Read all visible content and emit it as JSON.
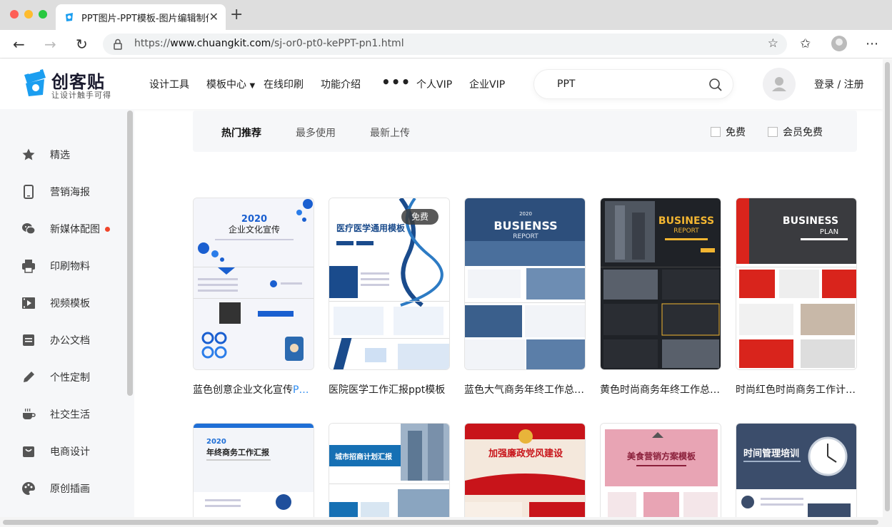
{
  "browser": {
    "tab_title": "PPT图片-PPT模板-图片编辑制作",
    "url_prefix": "https://",
    "url_domain": "www.chuangkit.com",
    "url_path": "/sj-or0-pt0-kePPT-pn1.html"
  },
  "site": {
    "logo_name": "创客贴",
    "logo_slogan": "让设计触手可得",
    "nav": [
      "设计工具",
      "模板中心",
      "在线印刷",
      "功能介绍",
      "个人VIP",
      "企业VIP"
    ],
    "search_value": "PPT",
    "login": "登录 / 注册",
    "brand_color": "#1b9ef0"
  },
  "sidebar": {
    "items": [
      {
        "label": "精选",
        "icon": "star-icon"
      },
      {
        "label": "营销海报",
        "icon": "phone-icon"
      },
      {
        "label": "新媒体配图",
        "icon": "wechat-icon"
      },
      {
        "label": "印刷物料",
        "icon": "printer-icon"
      },
      {
        "label": "视频模板",
        "icon": "video-icon"
      },
      {
        "label": "办公文档",
        "icon": "document-icon"
      },
      {
        "label": "个性定制",
        "icon": "pencil-icon"
      },
      {
        "label": "社交生活",
        "icon": "coffee-icon"
      },
      {
        "label": "电商设计",
        "icon": "shop-icon"
      },
      {
        "label": "原创插画",
        "icon": "palette-icon"
      }
    ]
  },
  "filters": {
    "tabs": [
      "热门推荐",
      "最多使用",
      "最新上传"
    ],
    "active": "热门推荐",
    "checks": [
      "免费",
      "会员免费"
    ]
  },
  "cards": [
    {
      "title_main": "蓝色创意企业文化宣传",
      "title_hl": "P…",
      "heading": "2020",
      "sub": "企业文化宣传"
    },
    {
      "title_main": "医院医学工作汇报ppt模板",
      "title_hl": "",
      "heading": "医疗医学通用模板",
      "badge": "免费"
    },
    {
      "title_main": "蓝色大气商务年终工作总…",
      "title_hl": "",
      "heading": "BUSIENSS",
      "sub": "REPORT",
      "year": "2020"
    },
    {
      "title_main": "黄色时尚商务年终工作总…",
      "title_hl": "",
      "heading": "BUSINESS",
      "sub": "REPORT"
    },
    {
      "title_main": "时尚红色时尚商务工作计…",
      "title_hl": "",
      "heading": "BUSINESS",
      "sub": "PLAN"
    }
  ],
  "cards_row2": [
    {
      "heading": "年终商务工作汇报",
      "year": "2020"
    },
    {
      "heading": "城市招商计划汇报"
    },
    {
      "heading": "加强廉政党风建设"
    },
    {
      "heading": "美食营销方案模板"
    },
    {
      "heading": "时间管理培训"
    }
  ]
}
